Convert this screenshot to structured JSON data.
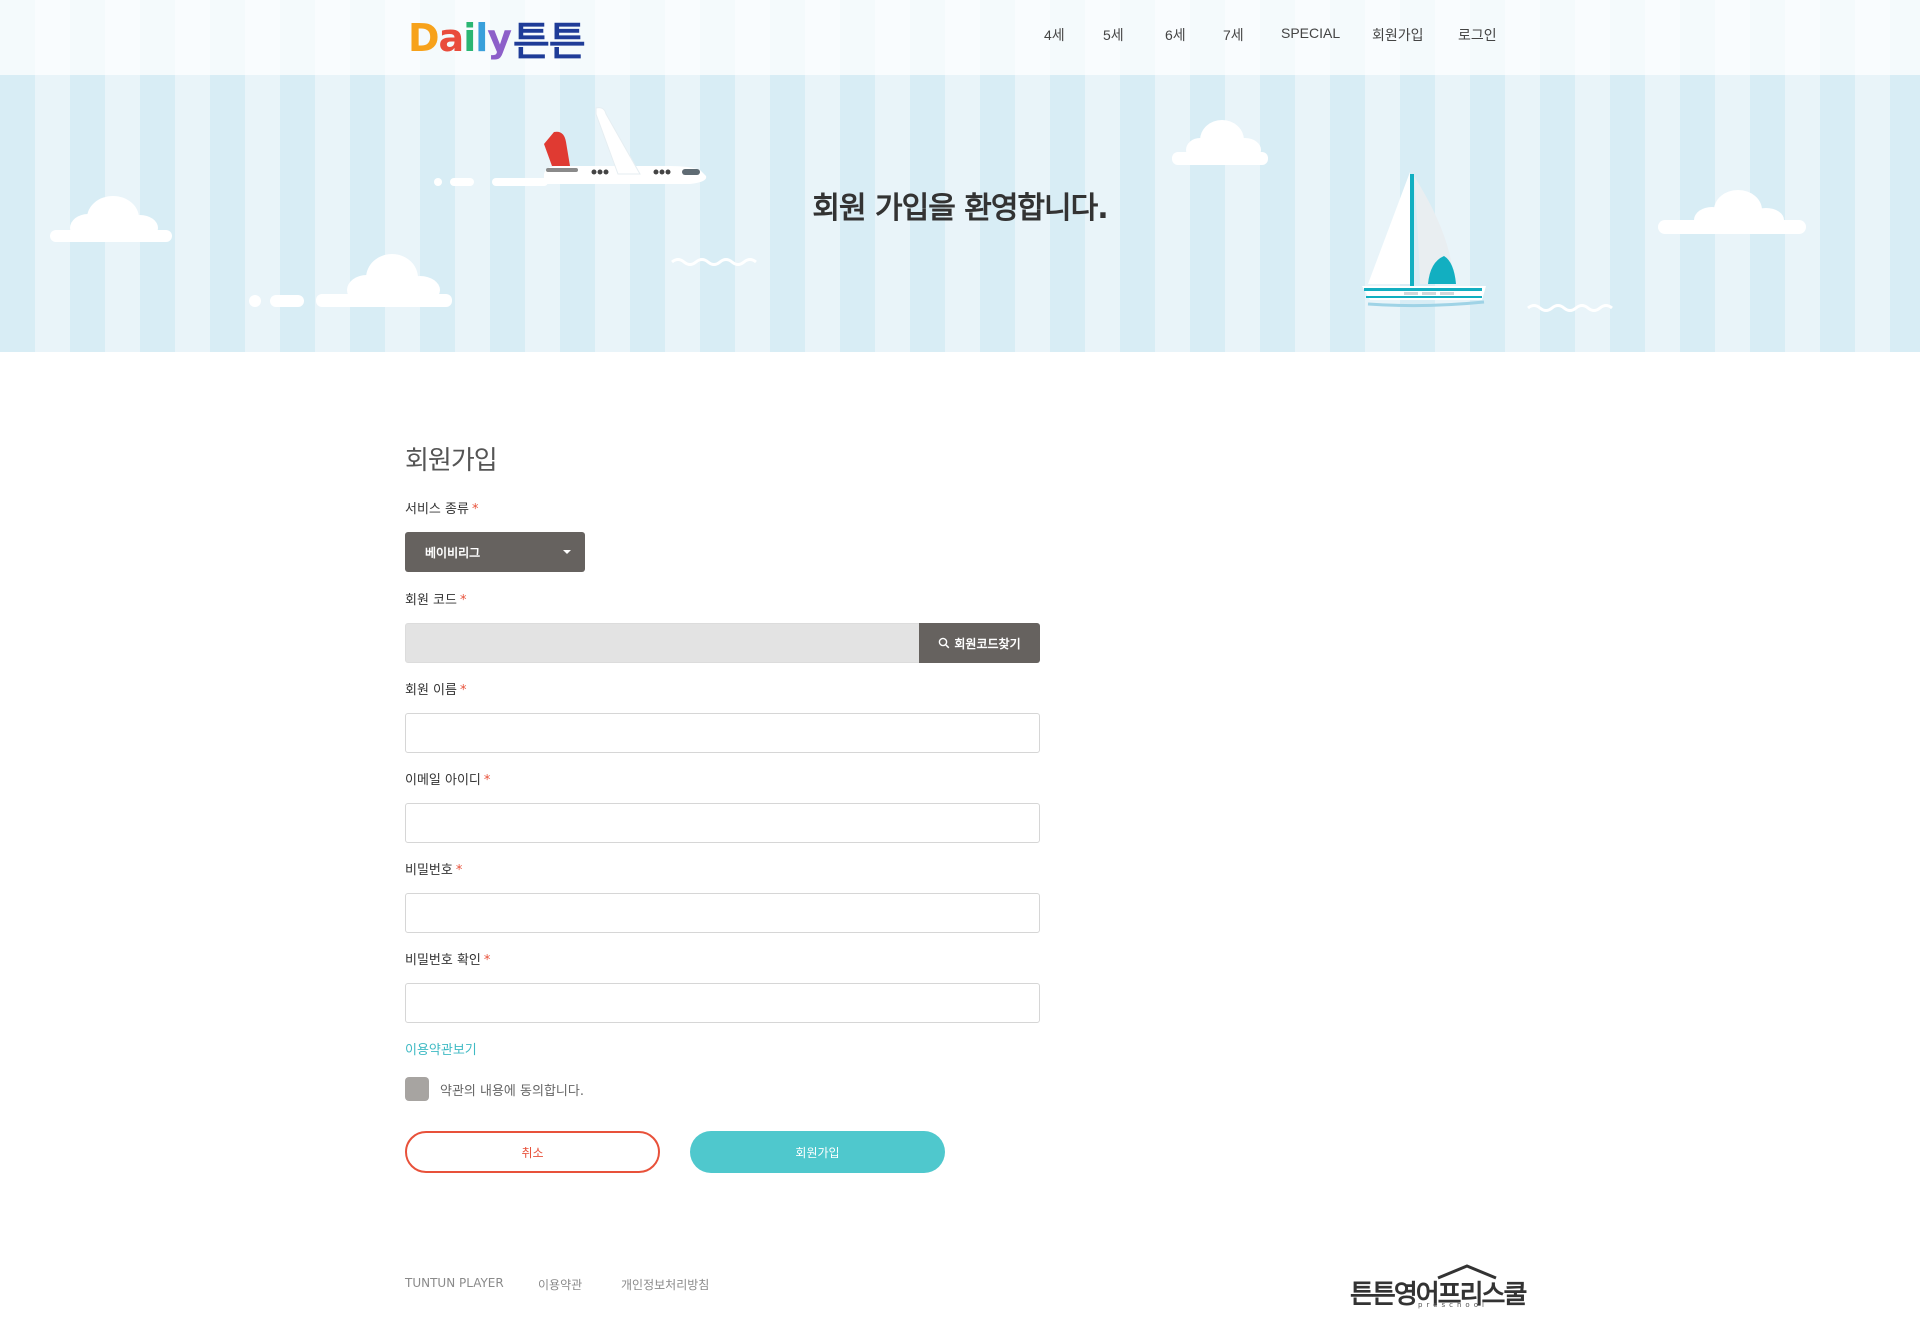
{
  "brand": {
    "logo_letters": [
      "D",
      "a",
      "i",
      "l",
      "y"
    ],
    "logo_korean": "튼튼"
  },
  "nav": {
    "items": [
      "4세",
      "5세",
      "6세",
      "7세",
      "SPECIAL",
      "회원가입",
      "로그인"
    ]
  },
  "hero": {
    "title": "회원 가입을 환영합니다."
  },
  "form": {
    "title": "회원가입",
    "service_type": {
      "label": "서비스 종류",
      "selected": "베이비리그"
    },
    "member_code": {
      "label": "회원 코드",
      "value": "",
      "button_label": "회원코드찾기"
    },
    "member_name": {
      "label": "회원 이름",
      "value": ""
    },
    "email_id": {
      "label": "이메일 아이디",
      "value": ""
    },
    "password": {
      "label": "비밀번호",
      "value": ""
    },
    "password_confirm": {
      "label": "비밀번호 확인",
      "value": ""
    },
    "required_mark": "*",
    "terms_link": "이용약관보기",
    "agree_text": "약관의 내용에 동의합니다.",
    "agree_checked": false,
    "cancel_label": "취소",
    "submit_label": "회원가입"
  },
  "footer": {
    "links": [
      "TUNTUN PLAYER",
      "이용약관",
      "개인정보처리방침"
    ],
    "logo_text": "튼튼영어프리스쿨",
    "logo_sub": "preschool"
  },
  "colors": {
    "accent_teal": "#4fc8cd",
    "cancel_red": "#e8513a",
    "dark_button": "#66625f",
    "hero_stripe_a": "#d8edf5",
    "hero_stripe_b": "#e9f4f9"
  }
}
